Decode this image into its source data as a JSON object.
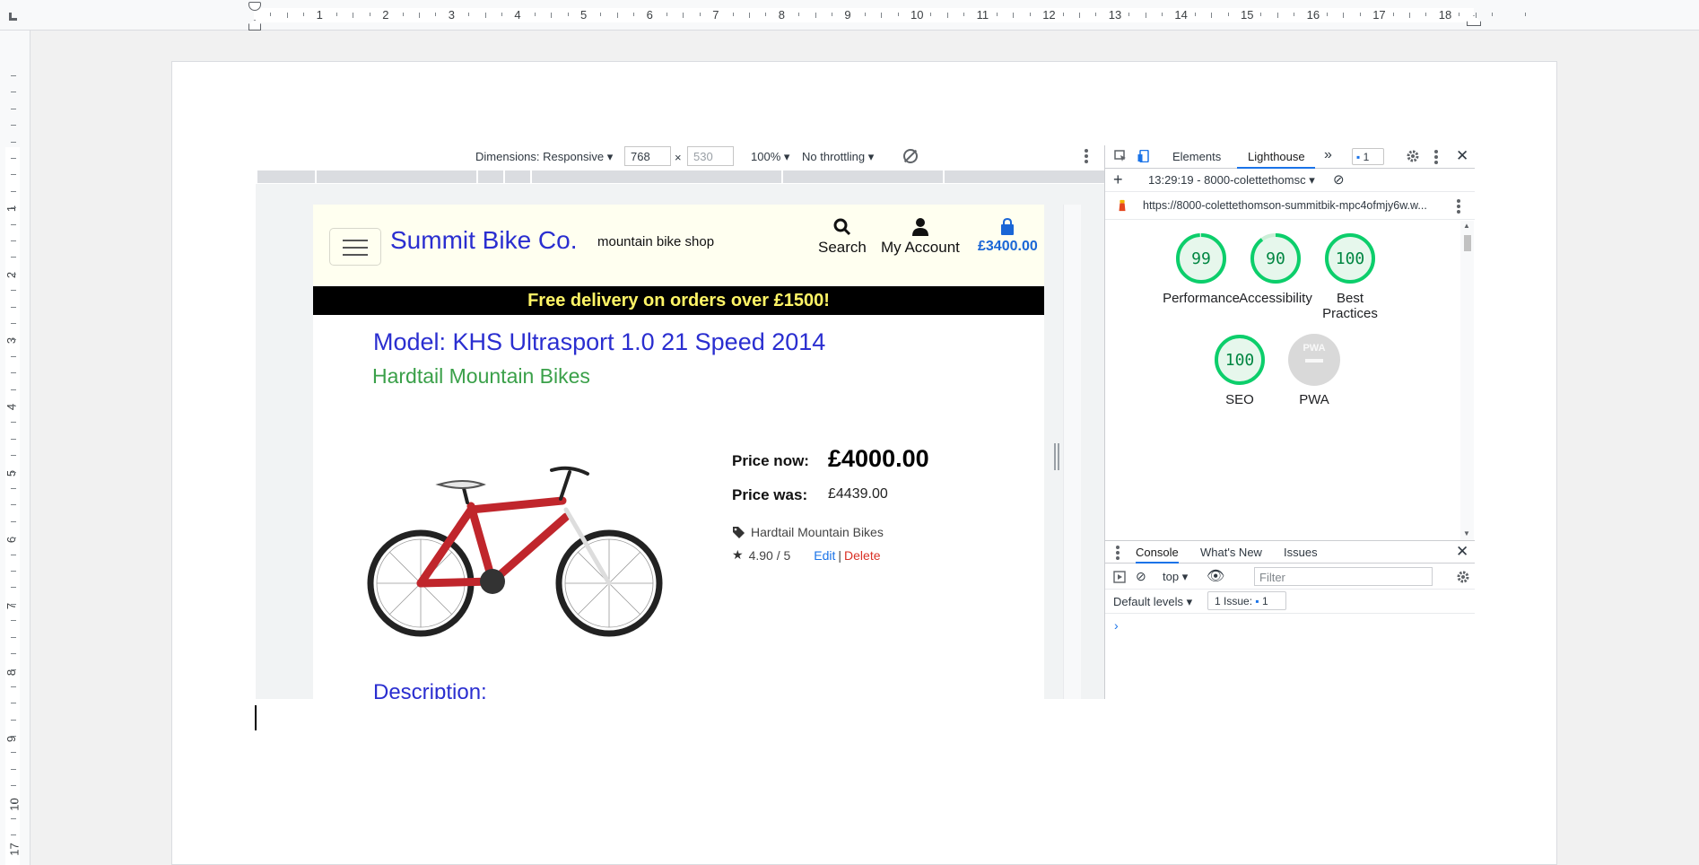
{
  "ruler": {
    "numbers": [
      "1",
      "2",
      "3",
      "4",
      "5",
      "6",
      "7",
      "8",
      "9",
      "10",
      "11",
      "12",
      "13",
      "14",
      "15",
      "16",
      "17",
      "18"
    ],
    "vertical_numbers": [
      "1",
      "2",
      "3",
      "4",
      "5",
      "6",
      "7",
      "8",
      "9",
      "10",
      "17"
    ]
  },
  "device_toolbar": {
    "dimensions_label": "Dimensions: Responsive",
    "width_value": "768",
    "height_value": "530",
    "times": "×",
    "zoom": "100%",
    "throttling": "No throttling"
  },
  "site": {
    "brand": "Summit Bike Co.",
    "tagline": "mountain bike shop",
    "search_label": "Search",
    "account_label": "My Account",
    "cart_total": "£3400.00",
    "banner": "Free delivery on orders over £1500!",
    "model_title": "Model: KHS Ultrasport 1.0 21 Speed 2014",
    "category_title": "Hardtail Mountain Bikes",
    "price_now_label": "Price now:",
    "price_now": "£4000.00",
    "price_was_label": "Price was:",
    "price_was": "£4439.00",
    "category_tag": "Hardtail Mountain Bikes",
    "rating": "4.90 / 5",
    "edit_label": "Edit",
    "separator": "|",
    "delete_label": "Delete",
    "description_heading": "Description:"
  },
  "devtools": {
    "tabs": {
      "elements": "Elements",
      "lighthouse": "Lighthouse",
      "more": "»"
    },
    "issues_count": "1",
    "report_time": "13:29:19 - 8000-colettethomsc",
    "report_url": "https://8000-colettethomson-summitbik-mpc4ofmjy6w.w...",
    "scores": [
      {
        "label": "Performance",
        "value": "99",
        "score": 99,
        "color": "#0cce6b"
      },
      {
        "label": "Accessibility",
        "value": "90",
        "score": 90,
        "color": "#0cce6b"
      },
      {
        "label": "Best Practices",
        "value": "100",
        "score": 100,
        "color": "#0cce6b"
      },
      {
        "label": "SEO",
        "value": "100",
        "score": 100,
        "color": "#0cce6b"
      }
    ],
    "pwa": {
      "label": "PWA",
      "badge": "PWA"
    },
    "drawer_tabs": {
      "console": "Console",
      "whats_new": "What's New",
      "issues": "Issues"
    },
    "context": "top",
    "filter_placeholder": "Filter",
    "default_levels": "Default levels",
    "issue_pill_text": "1 Issue:",
    "issue_pill_count": "1",
    "prompt": "›"
  }
}
